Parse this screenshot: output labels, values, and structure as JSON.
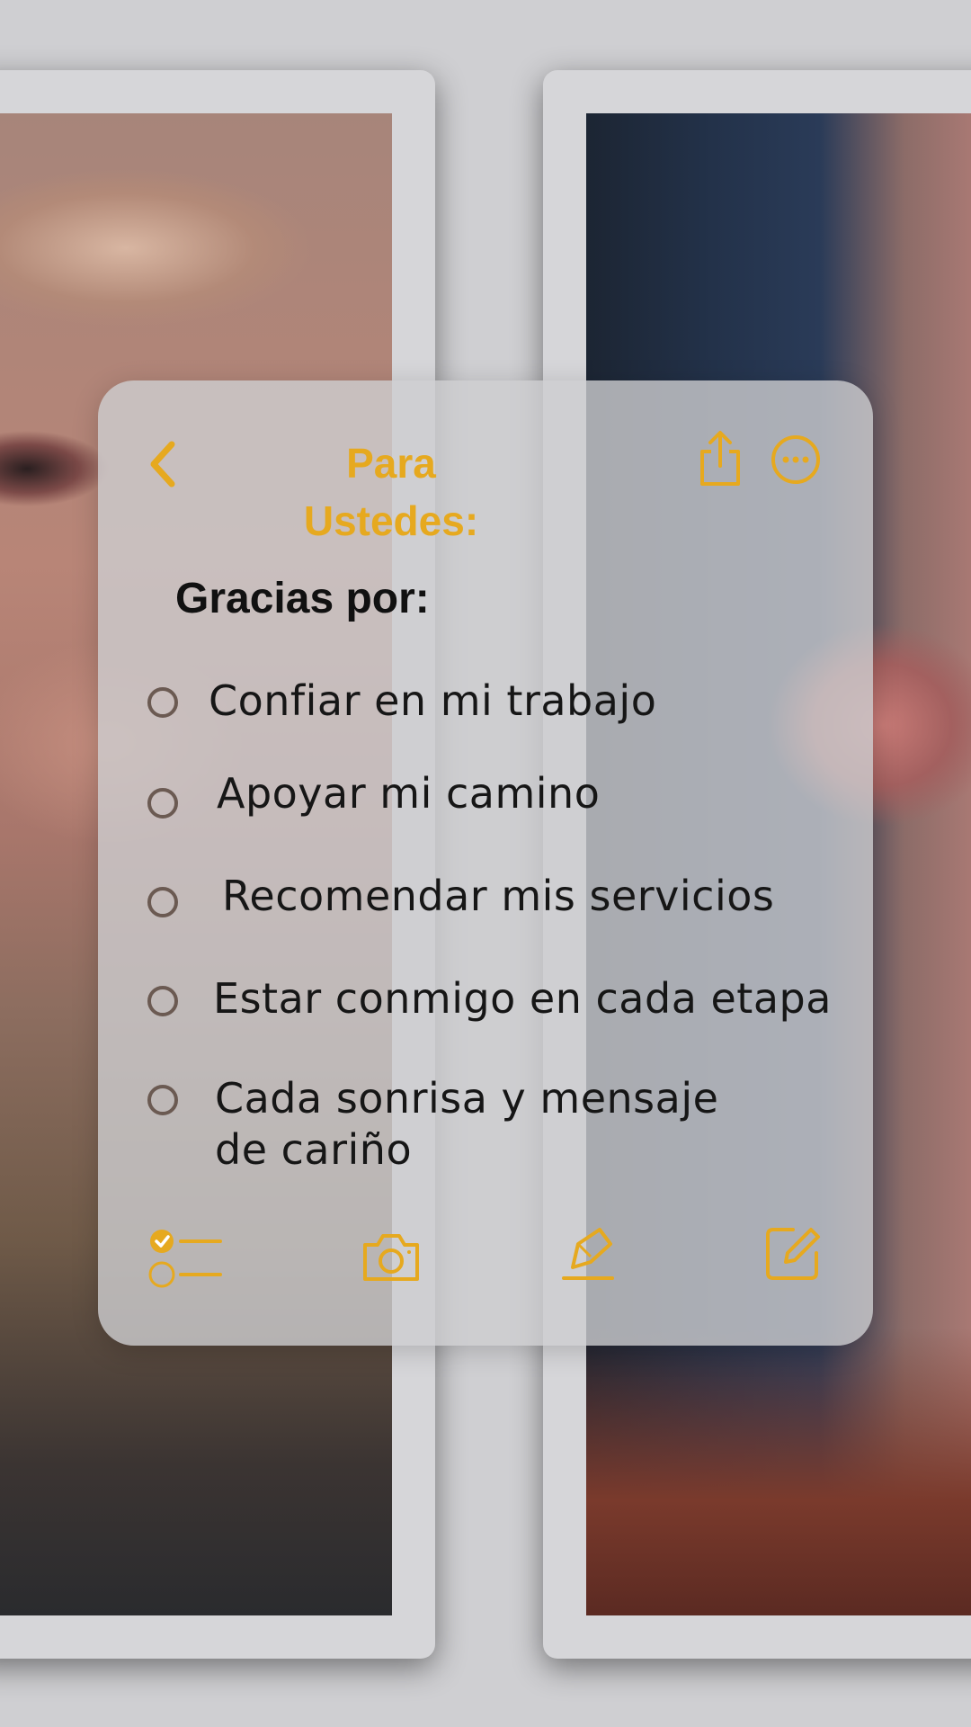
{
  "note": {
    "title": "Para Ustedes:",
    "heading": "Gracias por:",
    "tasks": [
      {
        "text": "Confiar en mi trabajo",
        "checked": false
      },
      {
        "text": "Apoyar mi camino",
        "checked": false
      },
      {
        "text": "Recomendar mis servicios",
        "checked": false
      },
      {
        "text": "Estar conmigo en cada etapa",
        "checked": false
      },
      {
        "text": "Cada sonrisa y mensaje de cariño",
        "line1": "Cada sonrisa y mensaje",
        "line2": "de cariño",
        "checked": false
      }
    ]
  },
  "icons": {
    "header": [
      "chevron-left-icon",
      "share-icon",
      "more-icon"
    ],
    "toolbar": [
      "checklist-icon",
      "camera-icon",
      "markup-pen-icon",
      "compose-icon"
    ]
  },
  "colors": {
    "accent": "#e6a91f",
    "card": "#cdcdd0",
    "text": "#161616"
  }
}
